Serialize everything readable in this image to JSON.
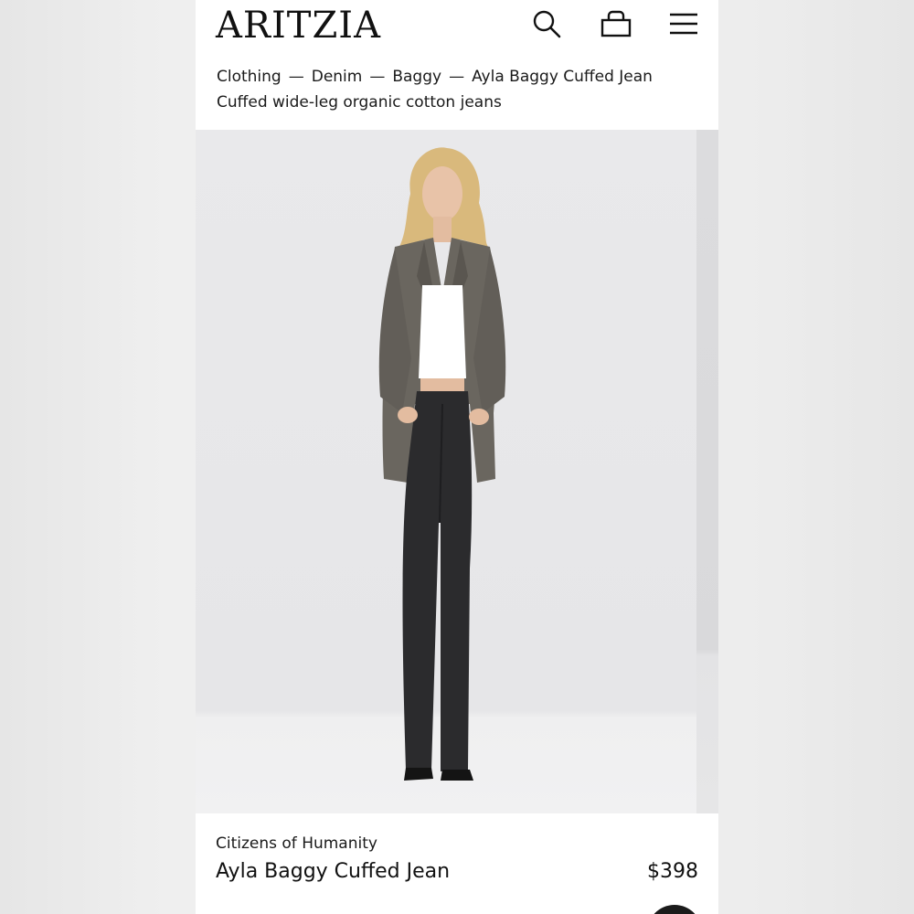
{
  "header": {
    "logo": "ARITZIA",
    "icons": [
      "search-icon",
      "bag-icon",
      "menu-icon"
    ]
  },
  "breadcrumb": {
    "items": [
      "Clothing",
      "Denim",
      "Baggy",
      "Ayla Baggy Cuffed Jean"
    ],
    "separator": "—"
  },
  "product": {
    "subtitle": "Cuffed wide-leg organic cotton jeans",
    "brand": "Citizens of Humanity",
    "name": "Ayla Baggy Cuffed Jean",
    "price": "$398"
  },
  "colors": {
    "text": "#111111",
    "photo_background": "#e8e8ea",
    "jeans": "#2b2b2d",
    "blazer": "#6a665f"
  }
}
